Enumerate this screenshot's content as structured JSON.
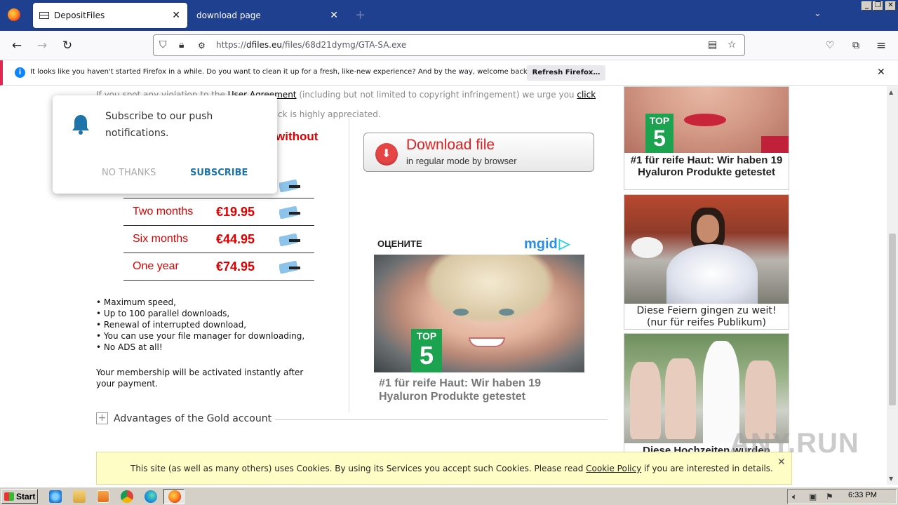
{
  "browser": {
    "tabs": [
      {
        "label": "DepositFiles",
        "active": true
      },
      {
        "label": "download page",
        "active": false
      }
    ],
    "url": {
      "scheme": "https://",
      "host": "dfiles.eu",
      "path": "/files/68d21dymg/GTA-SA.exe"
    },
    "notification": {
      "message": "It looks like you haven't started Firefox in a while. Do you want to clean it up for a fresh, like-new experience? And by the way, welcome back!",
      "button": "Refresh Firefox…"
    }
  },
  "page": {
    "violation": {
      "prefix": "If you spot any violation to the ",
      "link1": "User Agreement",
      "middle": " (including but not limited to copyright infringement) we urge you ",
      "link2": "click here",
      "suffix": " and",
      "line2": "ck is highly appreciated."
    },
    "push": {
      "text": "Subscribe to our push notifications.",
      "no": "NO THANKS",
      "yes": "SUBSCRIBE"
    },
    "without": "without",
    "prices": [
      {
        "period": "Two months",
        "amount": "€19.95"
      },
      {
        "period": "Six months",
        "amount": "€44.95"
      },
      {
        "period": "One year",
        "amount": "€74.95"
      }
    ],
    "features": [
      "Maximum speed,",
      "Up to 100 parallel downloads,",
      "Renewal of interrupted download,",
      "You can use your file manager for downloading,",
      "No ADS at all!"
    ],
    "activation": "Your membership will be activated instantly after your payment.",
    "download": {
      "title": "Download file",
      "subtitle": "in regular mode by browser"
    },
    "ad_header": {
      "rate": "ОЦЕНИТЕ",
      "brand": "mgid"
    },
    "main_ad": {
      "badge_top": "TOP",
      "badge_num": "5",
      "title": "#1 für reife Haut: Wir haben 19 Hyaluron Produkte getestet"
    },
    "advantages": "Advantages of the Gold account",
    "side_ads": [
      {
        "caption": "#1 für reife Haut: Wir haben 19 Hyaluron Produkte getestet",
        "badge_top": "TOP",
        "badge_num": "5"
      },
      {
        "caption": "Diese Feiern gingen zu weit! (nur für reifes Publikum)"
      },
      {
        "caption": "Diese Hochzeiten wurden"
      }
    ],
    "cookie": {
      "prefix": "This site (as well as many others) uses Cookies. By using its Services you accept such Cookies. Please read ",
      "link": "Cookie Policy",
      "suffix": " if you are interested in details."
    },
    "watermark": "ANY.RUN"
  },
  "taskbar": {
    "start": "Start",
    "clock": "6:33 PM"
  }
}
